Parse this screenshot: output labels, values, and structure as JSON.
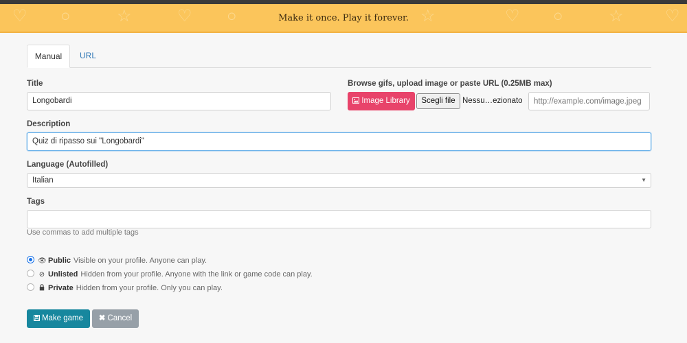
{
  "banner": {
    "text": "Make it once. Play it forever."
  },
  "tabs": [
    {
      "label": "Manual",
      "active": true
    },
    {
      "label": "URL",
      "active": false
    }
  ],
  "form": {
    "title": {
      "label": "Title",
      "value": "Longobardi"
    },
    "image": {
      "label": "Browse gifs, upload image or paste URL (0.25MB max)",
      "library_button": "Image Library",
      "library_icon": "image-icon",
      "file_button": "Scegli file",
      "file_name": "Nessu…ezionato",
      "url_placeholder": "http://example.com/image.jpeg"
    },
    "description": {
      "label": "Description",
      "value": "Quiz di ripasso sui \"Longobardi\""
    },
    "language": {
      "label": "Language (Autofilled)",
      "selected": "Italian"
    },
    "tags": {
      "label": "Tags",
      "value": "",
      "hint": "Use commas to add multiple tags"
    },
    "visibility": [
      {
        "name": "Public",
        "desc": "Visible on your profile. Anyone can play.",
        "icon": "eye-icon",
        "checked": true
      },
      {
        "name": "Unlisted",
        "desc": "Hidden from your profile. Anyone with the link or game code can play.",
        "icon": "eye-slash-icon",
        "checked": false
      },
      {
        "name": "Private",
        "desc": "Hidden from your profile. Only you can play.",
        "icon": "lock-icon",
        "checked": false
      }
    ]
  },
  "actions": {
    "make_label": "Make game",
    "make_icon": "save-icon",
    "cancel_label": "Cancel",
    "cancel_icon": "close-icon"
  },
  "colors": {
    "banner": "#fbc55b",
    "image_library": "#e8436a",
    "make_button": "#17879e",
    "cancel_button": "#97a0a8",
    "link": "#337ab7"
  }
}
